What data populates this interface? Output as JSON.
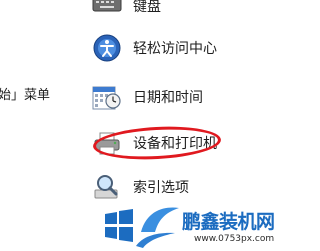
{
  "left_panel": {
    "fragment": "始」菜单"
  },
  "control_panel_items": [
    {
      "label": "键盘",
      "icon": "keyboard-icon"
    },
    {
      "label": "轻松访问中心",
      "icon": "ease-of-access-icon"
    },
    {
      "label": "日期和时间",
      "icon": "calendar-clock-icon"
    },
    {
      "label": "设备和打印机",
      "icon": "printer-icon"
    },
    {
      "label": "索引选项",
      "icon": "search-magnifier-icon"
    }
  ],
  "watermark": {
    "title": "鹏鑫装机网",
    "url": "www.0753px.com"
  },
  "colors": {
    "highlight": "#e0191f",
    "watermark_blue": "#1c6cc0"
  }
}
